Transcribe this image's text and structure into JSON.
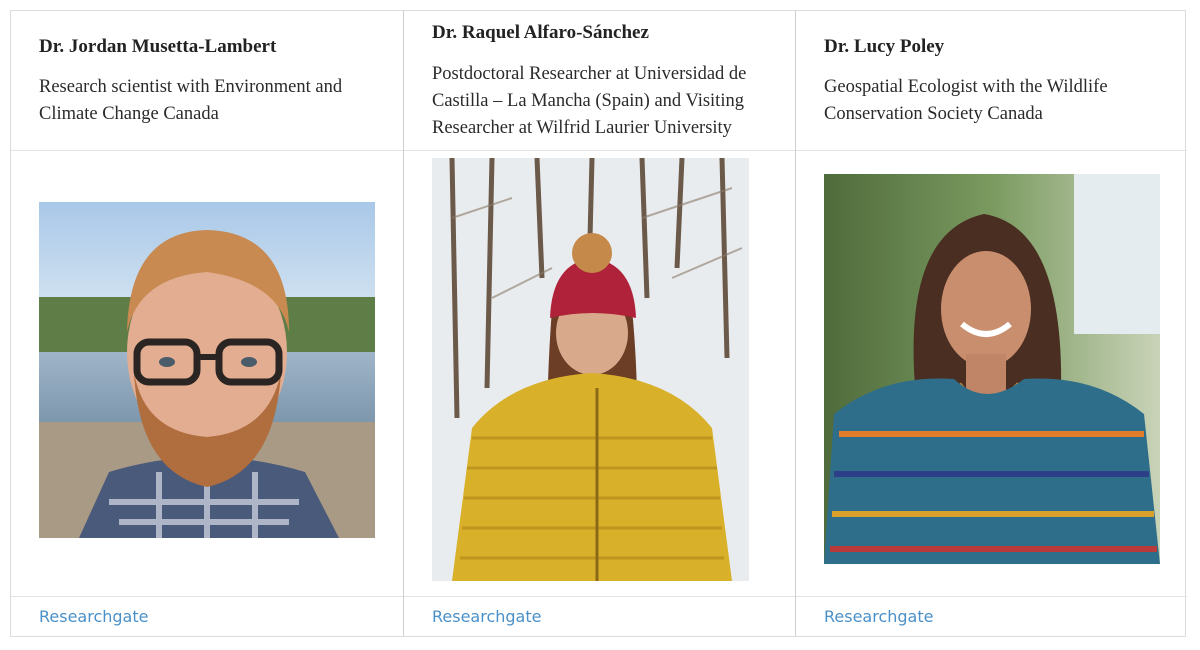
{
  "people": [
    {
      "name": "Dr. Jordan Musetta-Lambert",
      "description": "Research scientist with Environment and Climate Change Canada",
      "link_label": "Researchgate"
    },
    {
      "name": "Dr. Raquel Alfaro-Sánchez",
      "description": "Postdoctoral Researcher at Universidad de Castilla – La Mancha (Spain) and Visiting Researcher at Wilfrid Laurier University",
      "link_label": "Researchgate"
    },
    {
      "name": "Dr. Lucy Poley",
      "description": "Geospatial Ecologist with the Wildlife Conservation Society Canada",
      "link_label": "Researchgate"
    }
  ],
  "colors": {
    "link": "#4a90c8",
    "border": "#dcdcdc"
  }
}
